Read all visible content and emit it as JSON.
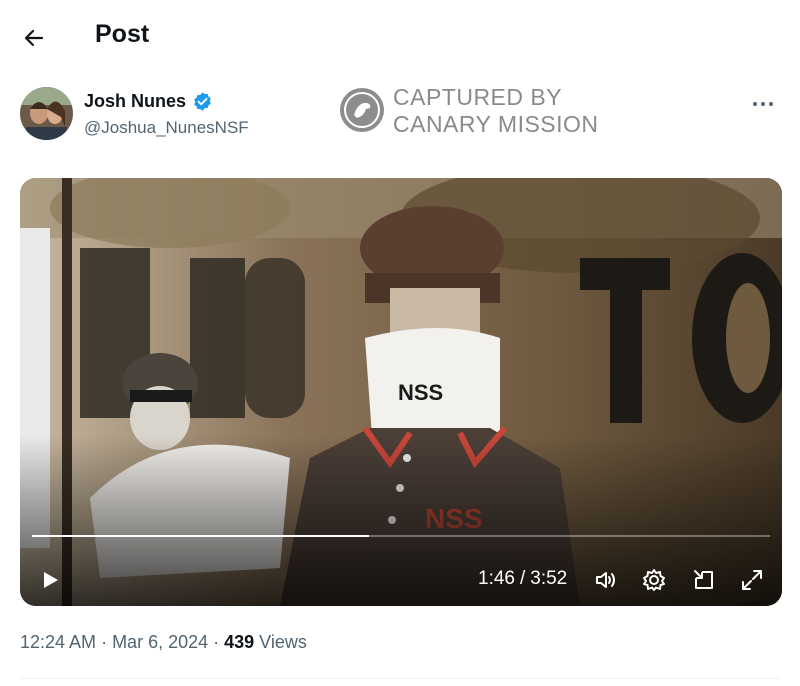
{
  "header": {
    "title": "Post"
  },
  "post": {
    "author": {
      "display_name": "Josh Nunes",
      "handle": "@Joshua_NunesNSF",
      "verified": true
    },
    "watermark": {
      "line1": "CAPTURED BY",
      "line2": "CANARY MISSION"
    },
    "video": {
      "current_time": "1:46",
      "separator": "/",
      "duration": "3:52",
      "progress": 0.4569
    },
    "meta": {
      "time": "12:24 AM",
      "dot": "·",
      "date": "Mar 6, 2024",
      "views_count": "439",
      "views_label": "Views"
    }
  },
  "colors": {
    "verified": "#1d9bf0",
    "text_primary": "#0f1419",
    "text_secondary": "#536471"
  }
}
